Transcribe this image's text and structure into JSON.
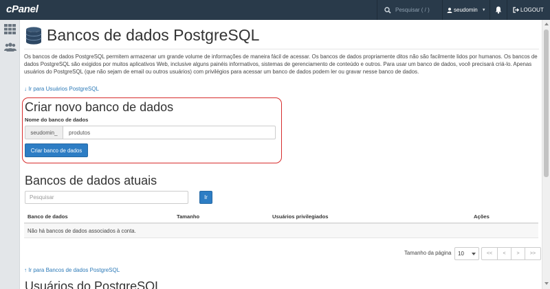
{
  "topbar": {
    "logo": "cPanel",
    "search_placeholder": "Pesquisar ( / )",
    "username": "seudomin",
    "logout_label": "LOGOUT",
    "background": "#293a4a"
  },
  "sidebar": {
    "items": [
      {
        "icon": "grid-icon"
      },
      {
        "icon": "users-icon"
      }
    ]
  },
  "page": {
    "title": "Bancos de dados PostgreSQL",
    "intro": "Os bancos de dados PostgreSQL permitem armazenar um grande volume de informações de maneira fácil de acessar. Os bancos de dados propriamente ditos não são facilmente lidos por humanos. Os bancos de dados PostgreSQL são exigidos por muitos aplicativos Web, inclusive alguns painéis informativos, sistemas de gerenciamento de conteúdo e outros. Para usar um banco de dados, você precisará criá-lo. Apenas usuários do PostgreSQL (que não sejam de email ou outros usuários) com privilégios para acessar um banco de dados podem ler ou gravar nesse banco de dados.",
    "jump_users_link": "↓ Ir para Usuários PostgreSQL"
  },
  "create": {
    "heading": "Criar novo banco de dados",
    "field_label": "Nome do banco de dados",
    "prefix": "seudomin_",
    "value": "produtos",
    "button": "Criar banco de dados",
    "highlight_color": "#d62b2b"
  },
  "current": {
    "heading": "Bancos de dados atuais",
    "search_placeholder": "Pesquisar",
    "go_button": "Ir",
    "columns": [
      "Banco de dados",
      "Tamanho",
      "Usuários privilegiados",
      "Ações"
    ],
    "empty_message": "Não há bancos de dados associados à conta.",
    "page_size_label": "Tamanho da página",
    "page_size": "10",
    "pager": [
      "<<",
      "<",
      ">",
      ">>"
    ],
    "jump_top_link": "↑ Ir para Bancos de dados PostgreSQL"
  },
  "users_section": {
    "heading": "Usuários do PostgreSQL"
  },
  "colors": {
    "primary_button": "#2d7dc4",
    "link": "#2c7ab8"
  }
}
